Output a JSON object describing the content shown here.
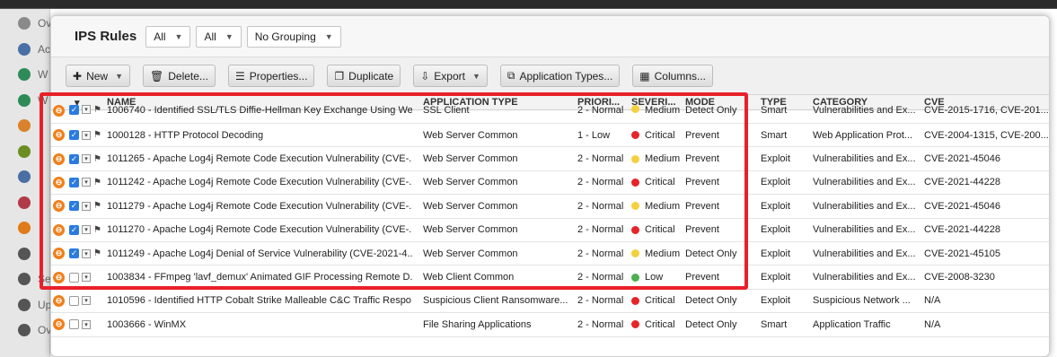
{
  "window": {
    "title": "IPS Rules"
  },
  "filters": [
    {
      "value": "All"
    },
    {
      "value": "All"
    },
    {
      "value": "No Grouping"
    }
  ],
  "toolbar": {
    "new_label": "New",
    "delete_label": "Delete...",
    "properties_label": "Properties...",
    "duplicate_label": "Duplicate",
    "export_label": "Export",
    "app_types_label": "Application Types...",
    "columns_label": "Columns..."
  },
  "sidebar": {
    "items": [
      {
        "label": "Ov",
        "icon": "dashboard-icon",
        "color": "#8a8a8a"
      },
      {
        "label": "Ac",
        "icon": "actions-icon",
        "color": "#4a6fa5"
      },
      {
        "label": "W",
        "icon": "web-icon",
        "color": "#2e8b57"
      },
      {
        "label": "W",
        "icon": "web-reputation-icon",
        "color": "#2e8b57"
      },
      {
        "label": "",
        "icon": "antimalware-icon",
        "color": "#d9822b"
      },
      {
        "label": "",
        "icon": "integrity-icon",
        "color": "#6b8e23"
      },
      {
        "label": "",
        "icon": "log-inspection-icon",
        "color": "#4a6fa5"
      },
      {
        "label": "",
        "icon": "firewall-icon",
        "color": "#b03a48"
      },
      {
        "label": "",
        "icon": "ips-icon",
        "color": "#e07b1a"
      },
      {
        "label": "",
        "icon": "application-control-icon",
        "color": "#555555"
      },
      {
        "label": "Se",
        "icon": "settings-icon",
        "color": "#555555"
      },
      {
        "label": "Up",
        "icon": "updates-icon",
        "color": "#555555"
      },
      {
        "label": "Ov",
        "icon": "overrides-icon",
        "color": "#555555"
      }
    ]
  },
  "columns": {
    "name": "NAME",
    "app_type": "APPLICATION TYPE",
    "priority": "PRIORI...",
    "severity": "SEVERI...",
    "mode": "MODE",
    "type": "TYPE",
    "category": "CATEGORY",
    "cve": "CVE"
  },
  "severity_colors": {
    "Critical": "#e5252a",
    "Medium": "#f4d03f",
    "Low": "#4caf50"
  },
  "rows": [
    {
      "checked": true,
      "name": "1006740 - Identified SSL/TLS Diffie-Hellman Key Exchange Using We...",
      "app_type": "SSL Client",
      "priority": "2 - Normal",
      "severity": "Medium",
      "mode": "Detect Only",
      "type": "Smart",
      "category": "Vulnerabilities and Ex...",
      "cve": "CVE-2015-1716, CVE-201..."
    },
    {
      "checked": true,
      "name": "1000128 - HTTP Protocol Decoding",
      "app_type": "Web Server Common",
      "priority": "1 - Low",
      "severity": "Critical",
      "mode": "Prevent",
      "type": "Smart",
      "category": "Web Application Prot...",
      "cve": "CVE-2004-1315, CVE-200..."
    },
    {
      "checked": true,
      "name": "1011265 - Apache Log4j Remote Code Execution Vulnerability (CVE-...",
      "app_type": "Web Server Common",
      "priority": "2 - Normal",
      "severity": "Medium",
      "mode": "Prevent",
      "type": "Exploit",
      "category": "Vulnerabilities and Ex...",
      "cve": "CVE-2021-45046"
    },
    {
      "checked": true,
      "name": "1011242 - Apache Log4j Remote Code Execution Vulnerability (CVE-...",
      "app_type": "Web Server Common",
      "priority": "2 - Normal",
      "severity": "Critical",
      "mode": "Prevent",
      "type": "Exploit",
      "category": "Vulnerabilities and Ex...",
      "cve": "CVE-2021-44228"
    },
    {
      "checked": true,
      "name": "1011279 - Apache Log4j Remote Code Execution Vulnerability (CVE-...",
      "app_type": "Web Server Common",
      "priority": "2 - Normal",
      "severity": "Medium",
      "mode": "Prevent",
      "type": "Exploit",
      "category": "Vulnerabilities and Ex...",
      "cve": "CVE-2021-45046"
    },
    {
      "checked": true,
      "name": "1011270 - Apache Log4j Remote Code Execution Vulnerability (CVE-...",
      "app_type": "Web Server Common",
      "priority": "2 - Normal",
      "severity": "Critical",
      "mode": "Prevent",
      "type": "Exploit",
      "category": "Vulnerabilities and Ex...",
      "cve": "CVE-2021-44228"
    },
    {
      "checked": true,
      "name": "1011249 - Apache Log4j Denial of Service Vulnerability (CVE-2021-4...",
      "app_type": "Web Server Common",
      "priority": "2 - Normal",
      "severity": "Medium",
      "mode": "Detect Only",
      "type": "Exploit",
      "category": "Vulnerabilities and Ex...",
      "cve": "CVE-2021-45105"
    },
    {
      "checked": false,
      "name": "1003834 - FFmpeg 'lavf_demux' Animated GIF Processing Remote D...",
      "app_type": "Web Client Common",
      "priority": "2 - Normal",
      "severity": "Low",
      "mode": "Prevent",
      "type": "Exploit",
      "category": "Vulnerabilities and Ex...",
      "cve": "CVE-2008-3230"
    },
    {
      "checked": false,
      "name": "1010596 - Identified HTTP Cobalt Strike Malleable C&C Traffic Respo...",
      "app_type": "Suspicious Client Ransomware...",
      "priority": "2 - Normal",
      "severity": "Critical",
      "mode": "Detect Only",
      "type": "Exploit",
      "category": "Suspicious Network ...",
      "cve": "N/A"
    },
    {
      "checked": false,
      "name": "1003666 - WinMX",
      "app_type": "File Sharing Applications",
      "priority": "2 - Normal",
      "severity": "Critical",
      "mode": "Detect Only",
      "type": "Smart",
      "category": "Application Traffic",
      "cve": "N/A"
    }
  ]
}
